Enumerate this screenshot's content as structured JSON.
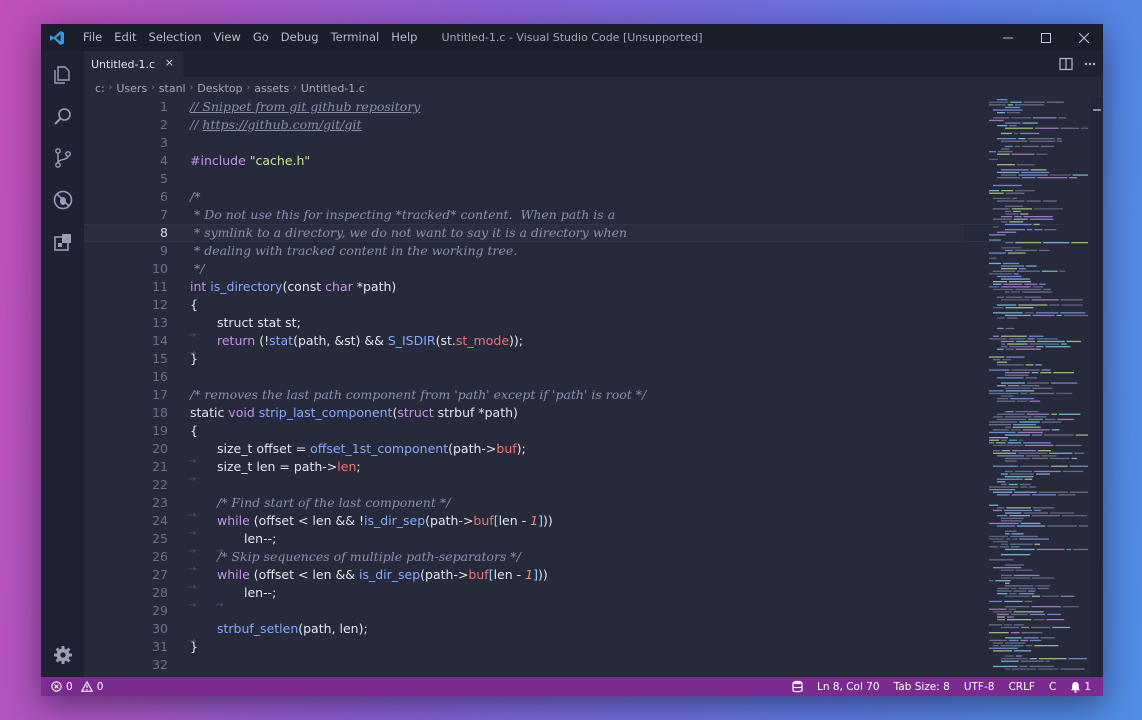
{
  "menu": [
    "File",
    "Edit",
    "Selection",
    "View",
    "Go",
    "Debug",
    "Terminal",
    "Help"
  ],
  "window_title": "Untitled-1.c - Visual Studio Code [Unsupported]",
  "tab": {
    "label": "Untitled-1.c",
    "close": "×"
  },
  "breadcrumbs": [
    "c:",
    "Users",
    "stanl",
    "Desktop",
    "assets",
    "Untitled-1.c"
  ],
  "editor": {
    "current_line": 8,
    "lines": [
      [
        [
          "c u",
          "// Snippet from git github repository"
        ]
      ],
      [
        [
          "c",
          "// "
        ],
        [
          "c u",
          "https://github.com/git/git"
        ]
      ],
      [],
      [
        [
          "p",
          "#include "
        ],
        [
          "s",
          "\"cache.h\""
        ]
      ],
      [],
      [
        [
          "c",
          "/*"
        ]
      ],
      [
        [
          "c",
          " * Do not use this for inspecting *tracked* content.  When path is a"
        ]
      ],
      [
        [
          "c",
          " * symlink to a directory, we do not want to say it is a directory when"
        ]
      ],
      [
        [
          "c",
          " * dealing with tracked content in the working tree."
        ]
      ],
      [
        [
          "c",
          " */"
        ]
      ],
      [
        [
          "k",
          "int "
        ],
        [
          "f",
          "is_directory"
        ],
        [
          "",
          "(const "
        ],
        [
          "k",
          "char "
        ],
        [
          "",
          "*path)"
        ]
      ],
      [
        [
          "",
          "{"
        ]
      ],
      [
        [
          "ig",
          "    "
        ],
        [
          "",
          "struct stat st;"
        ]
      ],
      [
        [
          "ig",
          "    "
        ],
        [
          "k",
          "return "
        ],
        [
          "",
          "(!"
        ],
        [
          "f",
          "stat"
        ],
        [
          "",
          "(path, &st) && "
        ],
        [
          "f",
          "S_ISDIR"
        ],
        [
          "",
          "(st."
        ],
        [
          "m",
          "st_mode"
        ],
        [
          "",
          "));"
        ]
      ],
      [
        [
          "",
          "}"
        ]
      ],
      [],
      [
        [
          "c",
          "/* removes the last path component from 'path' except if 'path' is root */"
        ]
      ],
      [
        [
          "",
          "static "
        ],
        [
          "k",
          "void "
        ],
        [
          "f",
          "strip_last_component"
        ],
        [
          "",
          "("
        ],
        [
          "k",
          "struct "
        ],
        [
          "",
          "strbuf *path)"
        ]
      ],
      [
        [
          "",
          "{"
        ]
      ],
      [
        [
          "ig",
          "    "
        ],
        [
          "",
          "size_t offset = "
        ],
        [
          "f",
          "offset_1st_component"
        ],
        [
          "",
          "(path->"
        ],
        [
          "m",
          "buf"
        ],
        [
          "",
          ");"
        ]
      ],
      [
        [
          "ig",
          "    "
        ],
        [
          "",
          "size_t len = path->"
        ],
        [
          "m",
          "len"
        ],
        [
          "",
          ";"
        ]
      ],
      [],
      [
        [
          "ig",
          "    "
        ],
        [
          "c",
          "/* Find start of the last component */"
        ]
      ],
      [
        [
          "ig",
          "    "
        ],
        [
          "k",
          "while "
        ],
        [
          "",
          "(offset < len && !"
        ],
        [
          "f",
          "is_dir_sep"
        ],
        [
          "",
          "(path->"
        ],
        [
          "m",
          "buf"
        ],
        [
          "q",
          "["
        ],
        [
          "",
          "len - "
        ],
        [
          "n",
          "1"
        ],
        [
          "q",
          "]"
        ],
        [
          "",
          "))"
        ]
      ],
      [
        [
          "ig",
          "    "
        ],
        [
          "ig",
          "    "
        ],
        [
          "",
          "len--;"
        ]
      ],
      [
        [
          "ig",
          "    "
        ],
        [
          "c",
          "/* Skip sequences of multiple path-separators */"
        ]
      ],
      [
        [
          "ig",
          "    "
        ],
        [
          "k",
          "while "
        ],
        [
          "",
          "(offset < len && "
        ],
        [
          "f",
          "is_dir_sep"
        ],
        [
          "",
          "(path->"
        ],
        [
          "m",
          "buf"
        ],
        [
          "q",
          "["
        ],
        [
          "",
          "len - "
        ],
        [
          "n",
          "1"
        ],
        [
          "q",
          "]"
        ],
        [
          "",
          "))"
        ]
      ],
      [
        [
          "ig",
          "    "
        ],
        [
          "ig",
          "    "
        ],
        [
          "",
          "len--;"
        ]
      ],
      [],
      [
        [
          "ig",
          "    "
        ],
        [
          "f",
          "strbuf_setlen"
        ],
        [
          "",
          "(path, len);"
        ]
      ],
      [
        [
          "",
          "}"
        ]
      ],
      []
    ]
  },
  "status": {
    "errors": "0",
    "warnings": "0",
    "position": "Ln 8, Col 70",
    "tab_size": "Tab Size: 8",
    "encoding": "UTF-8",
    "eol": "CRLF",
    "language": "C",
    "notifications": "1"
  },
  "colors": {
    "statusbar": "#7a2b8f",
    "editor_bg": "#262a3b",
    "keyword": "#c792ea",
    "function": "#82aaff",
    "string": "#c3e88d",
    "property": "#f07178",
    "number": "#f78c6c"
  },
  "icons": {
    "activity": [
      "explorer-icon",
      "search-icon",
      "source-control-icon",
      "debug-icon",
      "extensions-icon",
      "settings-gear-icon"
    ]
  }
}
